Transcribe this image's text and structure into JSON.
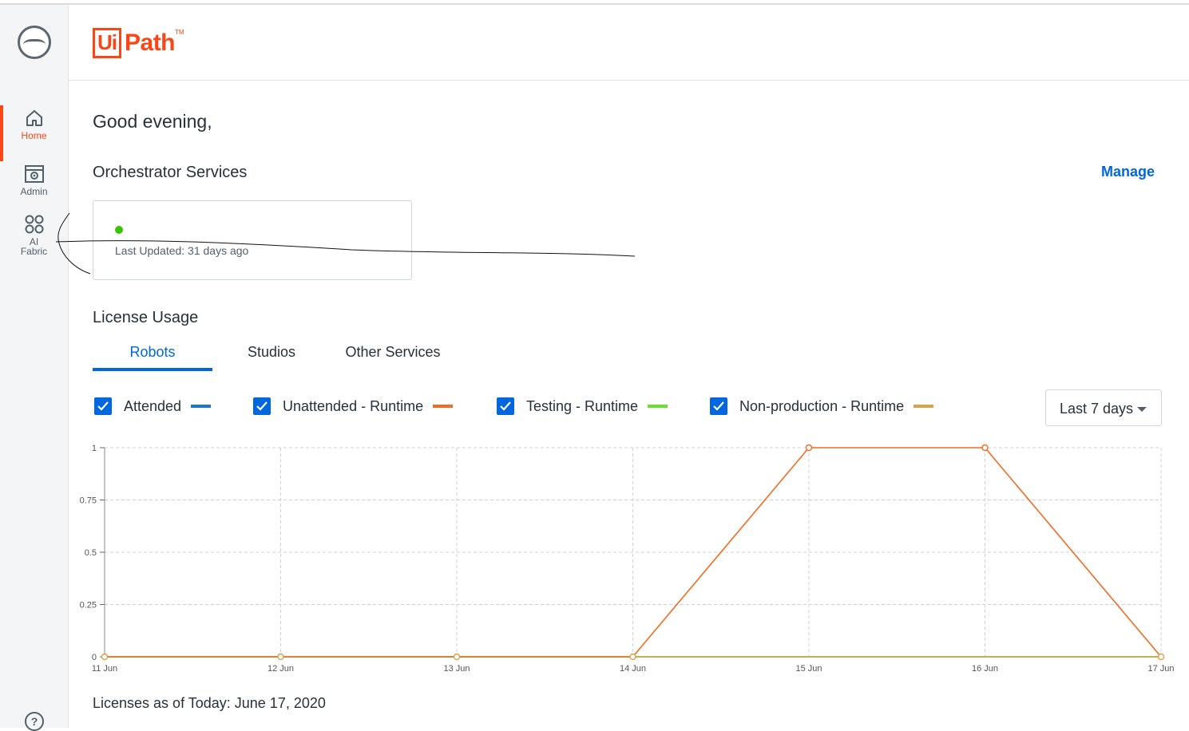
{
  "sidebar": {
    "items": [
      {
        "label": "Home"
      },
      {
        "label": "Admin"
      },
      {
        "label_line1": "AI",
        "label_line2": "Fabric"
      }
    ],
    "help": "?"
  },
  "header": {
    "logo_ui": "Ui",
    "logo_path": "Path",
    "logo_tm": "TM"
  },
  "main": {
    "greeting": "Good evening,",
    "orchestrator_title": "Orchestrator Services",
    "manage_label": "Manage",
    "service_card": {
      "last_updated": "Last Updated: 31 days ago"
    },
    "license_title": "License Usage",
    "tabs": [
      {
        "label": "Robots"
      },
      {
        "label": "Studios"
      },
      {
        "label": "Other Services"
      }
    ],
    "legend": [
      {
        "label": "Attended",
        "color": "#1976d2"
      },
      {
        "label": "Unattended - Runtime",
        "color": "#f26b21"
      },
      {
        "label": "Testing - Runtime",
        "color": "#66e22a"
      },
      {
        "label": "Non-production - Runtime",
        "color": "#d9a24a"
      }
    ],
    "range_select": "Last 7 days",
    "footer_note": "Licenses as of Today: June 17, 2020"
  },
  "chart_data": {
    "type": "line",
    "categories": [
      "11 Jun",
      "12 Jun",
      "13 Jun",
      "14 Jun",
      "15 Jun",
      "16 Jun",
      "17 Jun"
    ],
    "ylim": [
      0,
      1
    ],
    "yticks": [
      "0",
      "0.25",
      "0.5",
      "0.75",
      "1"
    ],
    "grid": true,
    "series": [
      {
        "name": "Attended",
        "color": "#1976d2",
        "values": [
          0,
          0,
          0,
          0,
          0,
          0,
          0
        ]
      },
      {
        "name": "Testing - Runtime",
        "color": "#66e22a",
        "values": [
          0,
          0,
          0,
          0,
          0,
          0,
          0
        ]
      },
      {
        "name": "Non-production - Runtime",
        "color": "#d9a24a",
        "values": [
          0,
          0,
          0,
          0,
          0,
          0,
          0
        ]
      },
      {
        "name": "Unattended - Runtime",
        "color": "#f26b21",
        "values": [
          0,
          0,
          0,
          0,
          1,
          1,
          0
        ]
      }
    ]
  }
}
